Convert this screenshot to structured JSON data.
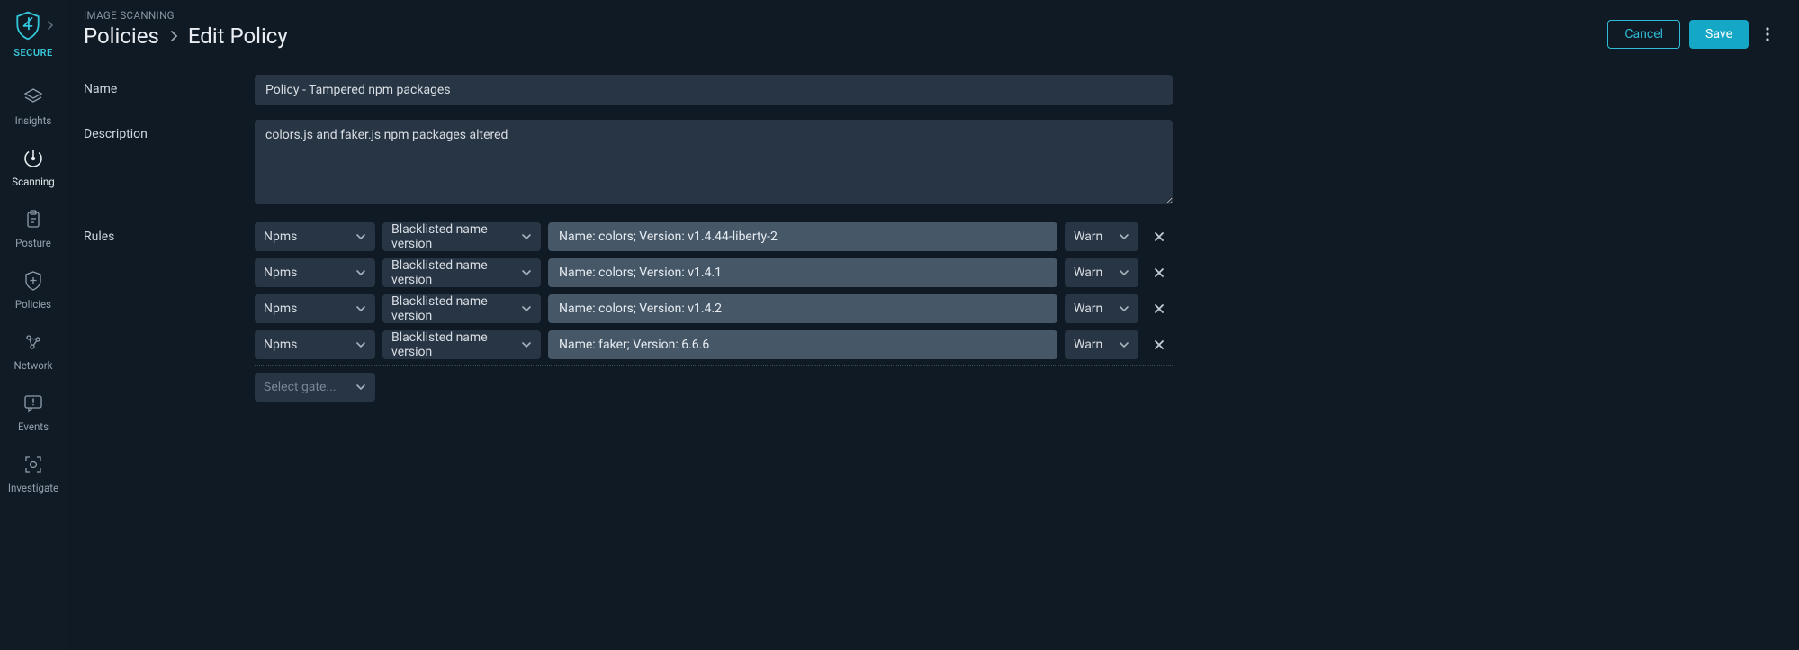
{
  "brand": {
    "label": "SECURE"
  },
  "sidebar": {
    "items": [
      {
        "id": "insights",
        "label": "Insights",
        "active": false
      },
      {
        "id": "scanning",
        "label": "Scanning",
        "active": true
      },
      {
        "id": "posture",
        "label": "Posture",
        "active": false
      },
      {
        "id": "policies",
        "label": "Policies",
        "active": false
      },
      {
        "id": "network",
        "label": "Network",
        "active": false
      },
      {
        "id": "events",
        "label": "Events",
        "active": false
      },
      {
        "id": "investigate",
        "label": "Investigate",
        "active": false
      }
    ]
  },
  "header": {
    "section": "IMAGE SCANNING",
    "breadcrumb_root": "Policies",
    "breadcrumb_current": "Edit Policy",
    "cancel_label": "Cancel",
    "save_label": "Save"
  },
  "form": {
    "name_label": "Name",
    "name_value": "Policy - Tampered npm packages",
    "description_label": "Description",
    "description_value": "colors.js and faker.js npm packages altered",
    "rules_label": "Rules",
    "add_gate_placeholder": "Select gate...",
    "rules": [
      {
        "gate": "Npms",
        "trigger": "Blacklisted name version",
        "params": "Name: colors; Version: v1.4.44-liberty-2",
        "action": "Warn"
      },
      {
        "gate": "Npms",
        "trigger": "Blacklisted name version",
        "params": "Name: colors; Version: v1.4.1",
        "action": "Warn"
      },
      {
        "gate": "Npms",
        "trigger": "Blacklisted name version",
        "params": "Name: colors; Version: v1.4.2",
        "action": "Warn"
      },
      {
        "gate": "Npms",
        "trigger": "Blacklisted name version",
        "params": "Name: faker; Version: 6.6.6",
        "action": "Warn"
      }
    ]
  }
}
